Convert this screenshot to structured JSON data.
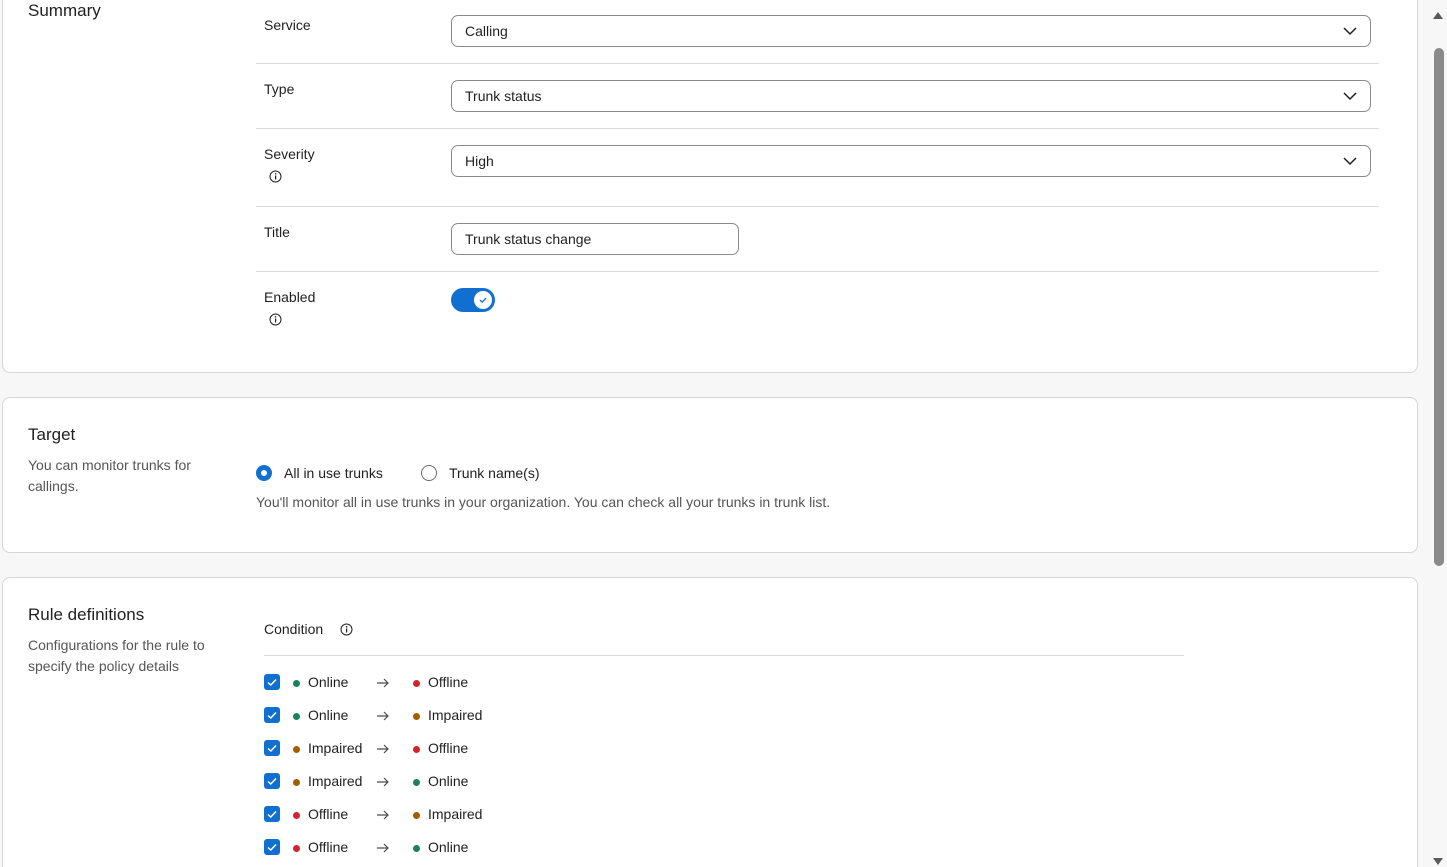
{
  "summary": {
    "title": "Summary",
    "service_label": "Service",
    "service_value": "Calling",
    "type_label": "Type",
    "type_value": "Trunk status",
    "severity_label": "Severity",
    "severity_value": "High",
    "title_label": "Title",
    "title_value": "Trunk status change",
    "enabled_label": "Enabled",
    "enabled": true
  },
  "target": {
    "title": "Target",
    "description": "You can monitor trunks for callings.",
    "options": [
      {
        "label": "All in use trunks",
        "selected": true
      },
      {
        "label": "Trunk name(s)",
        "selected": false
      }
    ],
    "help_text": "You'll monitor all in use trunks in your organization. You can check all your trunks in trunk list."
  },
  "rules": {
    "title": "Rule definitions",
    "description": "Configurations for the rule to specify the policy details",
    "condition_label": "Condition",
    "conditions": [
      {
        "from": "Online",
        "to": "Offline",
        "checked": true
      },
      {
        "from": "Online",
        "to": "Impaired",
        "checked": true
      },
      {
        "from": "Impaired",
        "to": "Offline",
        "checked": true
      },
      {
        "from": "Impaired",
        "to": "Online",
        "checked": true
      },
      {
        "from": "Offline",
        "to": "Impaired",
        "checked": true
      },
      {
        "from": "Offline",
        "to": "Online",
        "checked": true
      }
    ]
  },
  "colors": {
    "accent": "#1170cf",
    "online": "#1d805f",
    "impaired": "#a35e00",
    "offline": "#d4232d"
  },
  "icons": {
    "info": "info-icon",
    "chevron": "chevron-down-icon",
    "arrow": "arrow-right-icon",
    "check": "check-icon"
  }
}
